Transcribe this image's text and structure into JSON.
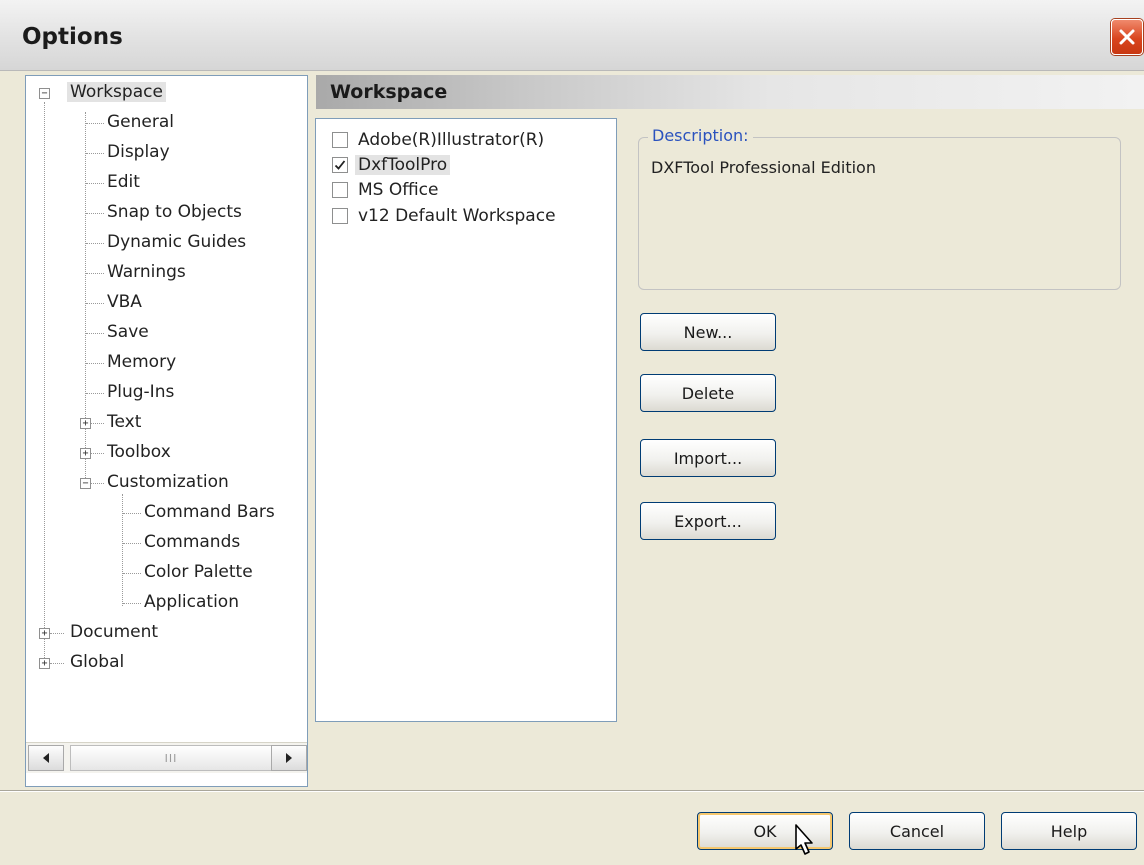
{
  "window": {
    "title": "Options"
  },
  "tree": {
    "items": [
      {
        "label": "Workspace",
        "expander": "minus",
        "selected": true
      },
      {
        "label": "General"
      },
      {
        "label": "Display"
      },
      {
        "label": "Edit"
      },
      {
        "label": "Snap to Objects"
      },
      {
        "label": "Dynamic Guides"
      },
      {
        "label": "Warnings"
      },
      {
        "label": "VBA"
      },
      {
        "label": "Save"
      },
      {
        "label": "Memory"
      },
      {
        "label": "Plug-Ins"
      },
      {
        "label": "Text",
        "expander": "plus"
      },
      {
        "label": "Toolbox",
        "expander": "plus"
      },
      {
        "label": "Customization",
        "expander": "minus"
      },
      {
        "label": "Command Bars"
      },
      {
        "label": "Commands"
      },
      {
        "label": "Color Palette"
      },
      {
        "label": "Application"
      },
      {
        "label": "Document",
        "expander": "plus"
      },
      {
        "label": "Global",
        "expander": "plus"
      }
    ],
    "scrollbar_grip": "III"
  },
  "workspace": {
    "header": "Workspace",
    "list": [
      {
        "label": "Adobe(R)Illustrator(R)",
        "checked": false
      },
      {
        "label": "DxfToolPro",
        "checked": true,
        "selected": true
      },
      {
        "label": "MS Office",
        "checked": false
      },
      {
        "label": "v12 Default Workspace",
        "checked": false
      }
    ],
    "description_label": "Description:",
    "description_text": "DXFTool Professional Edition",
    "buttons": {
      "new": "New...",
      "delete": "Delete",
      "import": "Import...",
      "export": "Export..."
    }
  },
  "footer": {
    "ok": "OK",
    "cancel": "Cancel",
    "help": "Help"
  },
  "icons": {
    "close": "close-icon",
    "scroll_left": "arrow-left-icon",
    "scroll_right": "arrow-right-icon",
    "checkmark": "checkmark-icon",
    "cursor": "mouse-pointer-icon"
  },
  "colors": {
    "dialog_bg": "#ece9d8",
    "close_button": "#d9451f",
    "description_label": "#2a52be",
    "button_border": "#003c74",
    "default_button_glow": "#f5c76e"
  }
}
